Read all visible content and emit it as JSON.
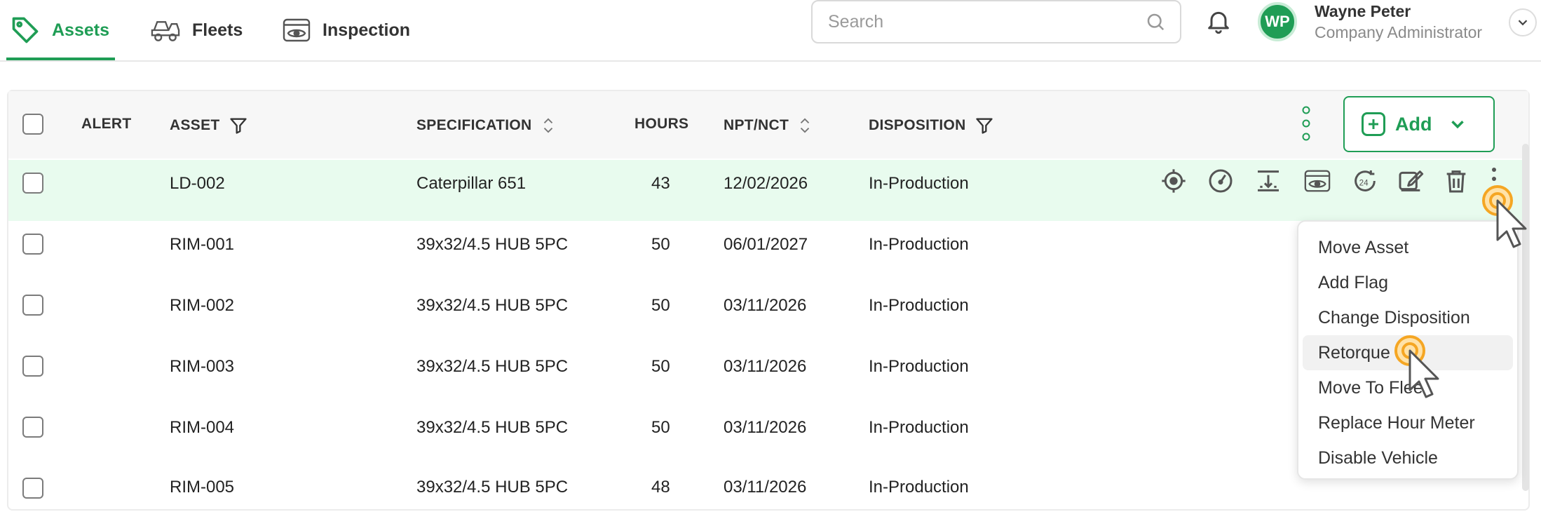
{
  "nav": {
    "tabs": [
      {
        "label": "Assets",
        "icon": "tag-icon",
        "active": true
      },
      {
        "label": "Fleets",
        "icon": "truck-icon"
      },
      {
        "label": "Inspection",
        "icon": "inspection-eye-icon"
      }
    ],
    "search": {
      "placeholder": "Search",
      "value": ""
    },
    "user": {
      "initials": "WP",
      "name": "Wayne Peter",
      "role": "Company Administrator"
    }
  },
  "table": {
    "columns": [
      "ALERT",
      "ASSET",
      "SPECIFICATION",
      "HOURS",
      "NPT/NCT",
      "DISPOSITION"
    ],
    "add_label": "Add",
    "rows": [
      {
        "asset": "LD-002",
        "spec": "Caterpillar 651",
        "hours": "43",
        "npt": "12/02/2026",
        "disposition": "In-Production"
      },
      {
        "asset": "RIM-001",
        "spec": "39x32/4.5 HUB 5PC",
        "hours": "50",
        "npt": "06/01/2027",
        "disposition": "In-Production"
      },
      {
        "asset": "RIM-002",
        "spec": "39x32/4.5 HUB 5PC",
        "hours": "50",
        "npt": "03/11/2026",
        "disposition": "In-Production"
      },
      {
        "asset": "RIM-003",
        "spec": "39x32/4.5 HUB 5PC",
        "hours": "50",
        "npt": "03/11/2026",
        "disposition": "In-Production"
      },
      {
        "asset": "RIM-004",
        "spec": "39x32/4.5 HUB 5PC",
        "hours": "50",
        "npt": "03/11/2026",
        "disposition": "In-Production"
      },
      {
        "asset": "RIM-005",
        "spec": "39x32/4.5 HUB 5PC",
        "hours": "48",
        "npt": "03/11/2026",
        "disposition": "In-Production"
      }
    ]
  },
  "row_actions": [
    "locate-icon",
    "gauge-icon",
    "measure-icon",
    "inspect-icon",
    "hour-meter-icon",
    "edit-icon",
    "delete-icon",
    "more-vertical-icon"
  ],
  "menu": {
    "items": [
      "Move Asset",
      "Add Flag",
      "Change Disposition",
      "Retorque",
      "Move To Fleet",
      "Replace Hour Meter",
      "Disable Vehicle"
    ],
    "active_index": 3
  },
  "colors": {
    "brand": "#1f9d55",
    "row_highlight": "#e8fbee",
    "cursor_ring": "#f5a623"
  }
}
